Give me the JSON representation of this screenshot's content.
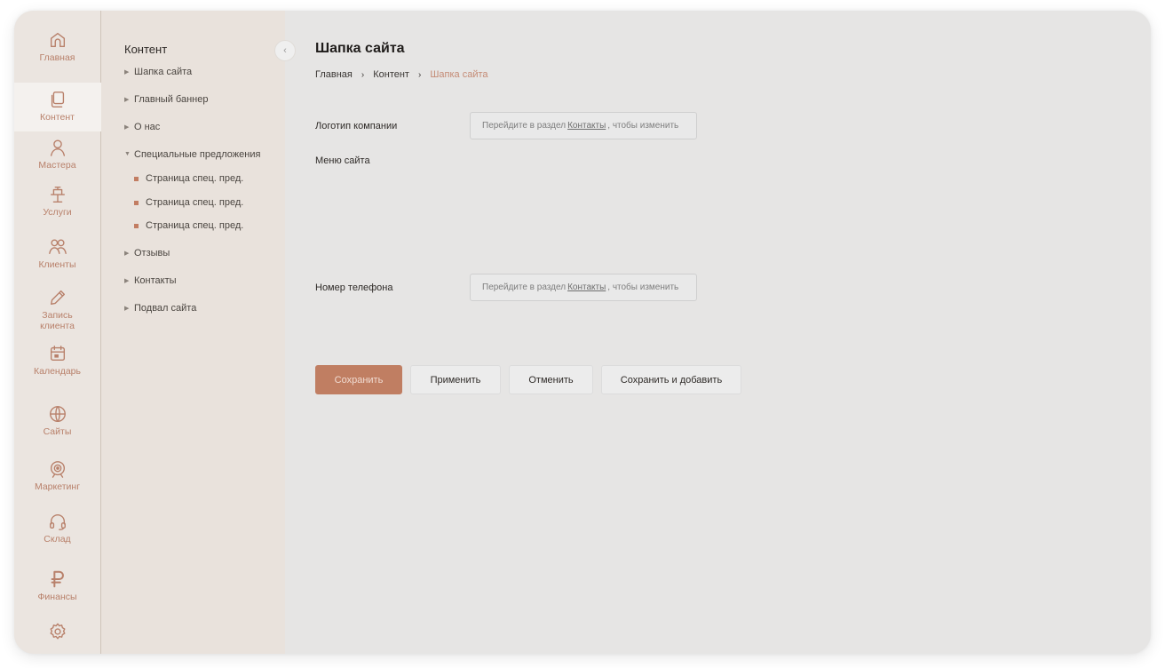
{
  "nav": {
    "items": [
      {
        "label": "Главная",
        "icon": "home-icon"
      },
      {
        "label": "Контент",
        "icon": "copy-icon"
      },
      {
        "label": "Мастера",
        "icon": "user-icon"
      },
      {
        "label": "Услуги",
        "icon": "chair-icon"
      },
      {
        "label": "Клиенты",
        "icon": "users-icon"
      },
      {
        "label": "Запись клиента",
        "icon": "pencil-icon"
      },
      {
        "label": "Календарь",
        "icon": "calendar-icon"
      },
      {
        "label": "Сайты",
        "icon": "globe-icon"
      },
      {
        "label": "Маркетинг",
        "icon": "target-icon"
      },
      {
        "label": "Склад",
        "icon": "headset-icon"
      },
      {
        "label": "Финансы",
        "icon": "ruble-icon"
      },
      {
        "label": "",
        "icon": "gear-icon"
      }
    ]
  },
  "tree": {
    "title": "Контент",
    "items": [
      "Шапка сайта",
      "Главный баннер",
      "О нас",
      "Специальные предложения"
    ],
    "sub_items": [
      "Страница спец. пред.",
      "Страница спец. пред.",
      "Страница спец. пред."
    ],
    "items_after": [
      "Отзывы",
      "Контакты",
      "Подвал сайта"
    ],
    "collapse_glyph": "‹"
  },
  "main": {
    "title": "Шапка сайта",
    "breadcrumb": [
      "Главная",
      "Контент",
      "Шапка сайта"
    ],
    "breadcrumb_sep": "›",
    "logo_label": "Логотип компании",
    "menu_label": "Меню сайта",
    "phone_label": "Номер телефона",
    "field_prefix": "Перейдите в раздел",
    "field_link": "Контакты",
    "field_suffix": ", чтобы изменить",
    "buttons": {
      "save": "Сохранить",
      "apply": "Применить",
      "cancel": "Отменить",
      "save_add": "Сохранить и добавить"
    }
  },
  "colors": {
    "accent": "#c07e62",
    "nav_icon": "#b8806a",
    "background": "#e6e5e4"
  }
}
